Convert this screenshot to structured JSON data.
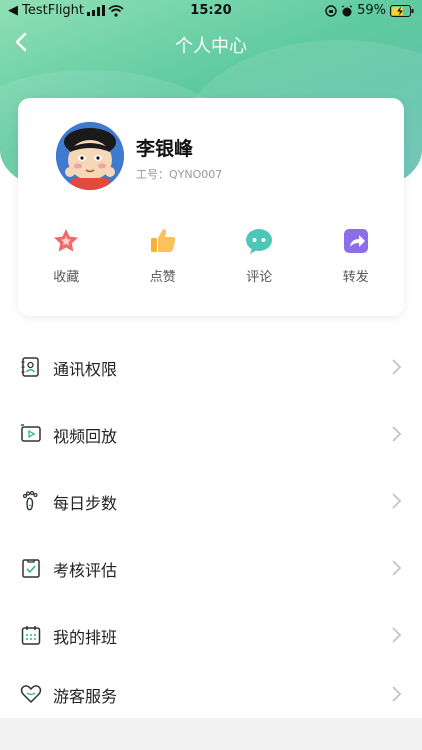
{
  "status_bar": {
    "carrier": "◀ TestFlight",
    "time": "15:20",
    "battery": "59%"
  },
  "nav": {
    "title": "个人中心"
  },
  "profile": {
    "name": "李银峰",
    "employee_id": "工号：QYNO007"
  },
  "actions": [
    {
      "label": "收藏",
      "icon": "star-icon",
      "color": "#f06a6a"
    },
    {
      "label": "点赞",
      "icon": "thumbs-up-icon",
      "color": "#f7b23b"
    },
    {
      "label": "评论",
      "icon": "comment-icon",
      "color": "#4fc7b8"
    },
    {
      "label": "转发",
      "icon": "share-icon",
      "color": "#8b6ee8"
    }
  ],
  "menu": [
    {
      "label": "通讯权限",
      "icon": "contacts-book-icon"
    },
    {
      "label": "视频回放",
      "icon": "video-playback-icon"
    },
    {
      "label": "每日步数",
      "icon": "footprint-icon"
    },
    {
      "label": "考核评估",
      "icon": "clipboard-check-icon"
    },
    {
      "label": "我的排班",
      "icon": "calendar-icon"
    },
    {
      "label": "游客服务",
      "icon": "heart-icon"
    }
  ],
  "colors": {
    "header_gradient_start": "#8fe0b4",
    "header_gradient_end": "#66c0b4",
    "icon_stroke": "#333333",
    "chevron": "#c4c4c4"
  }
}
